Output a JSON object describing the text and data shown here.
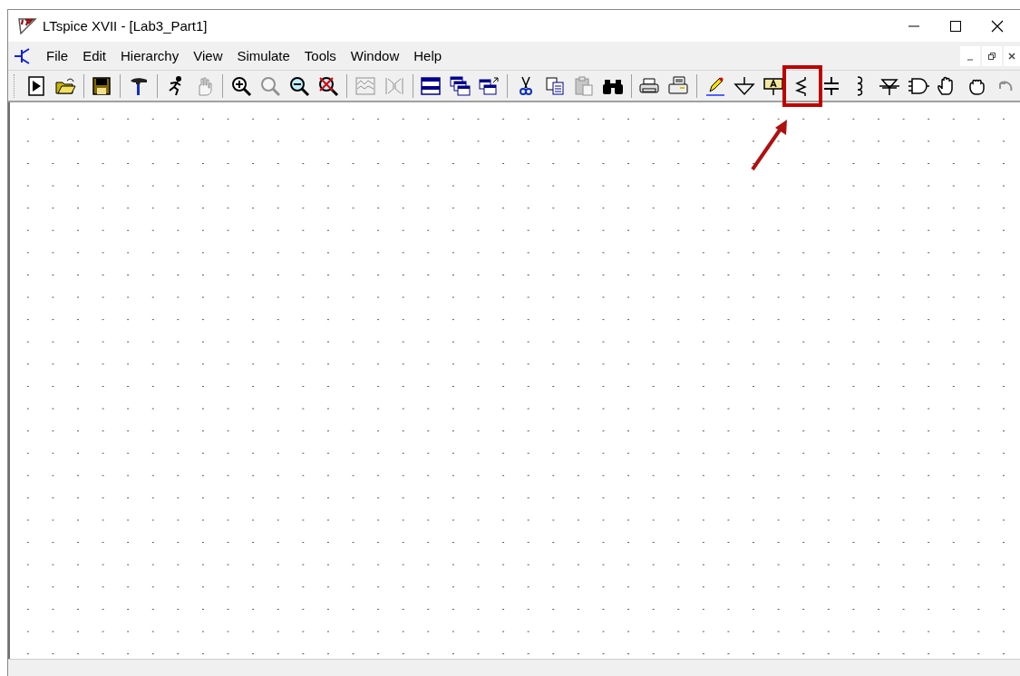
{
  "window": {
    "title": "LTspice XVII - [Lab3_Part1]"
  },
  "menu": [
    {
      "label": "File"
    },
    {
      "label": "Edit"
    },
    {
      "label": "Hierarchy"
    },
    {
      "label": "View"
    },
    {
      "label": "Simulate"
    },
    {
      "label": "Tools"
    },
    {
      "label": "Window"
    },
    {
      "label": "Help"
    }
  ],
  "toolbar": [
    {
      "kind": "run",
      "disabled": false,
      "highlighted": false
    },
    {
      "kind": "open",
      "disabled": false,
      "highlighted": false
    },
    {
      "kind": "separator"
    },
    {
      "kind": "save",
      "disabled": false,
      "highlighted": false
    },
    {
      "kind": "separator"
    },
    {
      "kind": "hammer",
      "disabled": false,
      "highlighted": false
    },
    {
      "kind": "separator"
    },
    {
      "kind": "runner",
      "disabled": false,
      "highlighted": false
    },
    {
      "kind": "hand",
      "disabled": true,
      "highlighted": false
    },
    {
      "kind": "separator"
    },
    {
      "kind": "zoomin",
      "disabled": false,
      "highlighted": false
    },
    {
      "kind": "zoomfit",
      "disabled": true,
      "highlighted": false
    },
    {
      "kind": "zoomout",
      "disabled": false,
      "highlighted": false
    },
    {
      "kind": "zoomcancel",
      "disabled": false,
      "highlighted": false
    },
    {
      "kind": "separator"
    },
    {
      "kind": "waveform",
      "disabled": true,
      "highlighted": false
    },
    {
      "kind": "bracket",
      "disabled": true,
      "highlighted": false
    },
    {
      "kind": "separator"
    },
    {
      "kind": "tile",
      "disabled": false,
      "highlighted": false
    },
    {
      "kind": "cascade",
      "disabled": false,
      "highlighted": false
    },
    {
      "kind": "arrange",
      "disabled": false,
      "highlighted": false
    },
    {
      "kind": "separator"
    },
    {
      "kind": "cut",
      "disabled": false,
      "highlighted": false
    },
    {
      "kind": "copy",
      "disabled": false,
      "highlighted": false
    },
    {
      "kind": "paste",
      "disabled": true,
      "highlighted": false
    },
    {
      "kind": "find",
      "disabled": false,
      "highlighted": false
    },
    {
      "kind": "separator"
    },
    {
      "kind": "printpreview",
      "disabled": false,
      "highlighted": false
    },
    {
      "kind": "print",
      "disabled": false,
      "highlighted": false
    },
    {
      "kind": "separator"
    },
    {
      "kind": "wire",
      "disabled": false,
      "highlighted": false
    },
    {
      "kind": "ground",
      "disabled": false,
      "highlighted": false
    },
    {
      "kind": "label",
      "disabled": false,
      "highlighted": false
    },
    {
      "kind": "resistor",
      "disabled": false,
      "highlighted": true
    },
    {
      "kind": "capacitor",
      "disabled": false,
      "highlighted": false
    },
    {
      "kind": "inductor",
      "disabled": false,
      "highlighted": false
    },
    {
      "kind": "diode",
      "disabled": false,
      "highlighted": false
    },
    {
      "kind": "component",
      "disabled": false,
      "highlighted": false
    },
    {
      "kind": "move",
      "disabled": false,
      "highlighted": false
    },
    {
      "kind": "drag",
      "disabled": false,
      "highlighted": false
    },
    {
      "kind": "undo",
      "disabled": true,
      "highlighted": false
    }
  ]
}
